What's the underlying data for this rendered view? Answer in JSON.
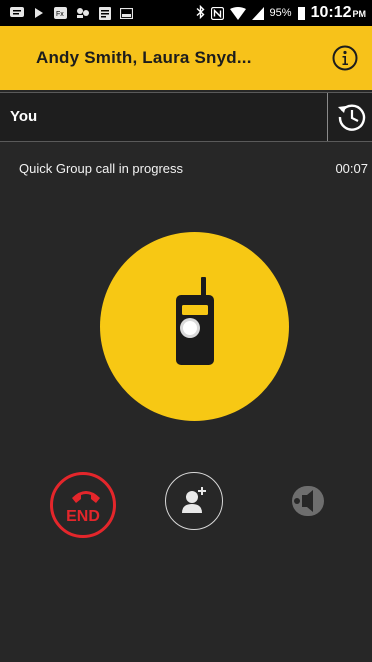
{
  "status_bar": {
    "battery_percent": "95%",
    "time": "10:12",
    "ampm": "PM",
    "icons": [
      "notification-icon",
      "play-icon",
      "fx-icon",
      "contacts-icon",
      "document-icon",
      "image-icon",
      "bluetooth-icon",
      "nfc-icon",
      "wifi-icon",
      "signal-icon",
      "battery-icon"
    ]
  },
  "header": {
    "title": "Andy Smith, Laura Snyd...",
    "accent_color": "#f7c21a",
    "info_icon": "info-icon"
  },
  "speaker_row": {
    "label": "You",
    "history_icon": "history-icon"
  },
  "call": {
    "status_text": "Quick Group call in progress",
    "timer": "00:07",
    "ptt_color": "#f7c814",
    "ptt_icon": "radio-icon"
  },
  "actions": {
    "end_label": "END",
    "end_color": "#e4262b",
    "end_icon": "phone-hangup-icon",
    "add_icon": "add-participant-icon",
    "speaker_icon": "speaker-icon"
  }
}
